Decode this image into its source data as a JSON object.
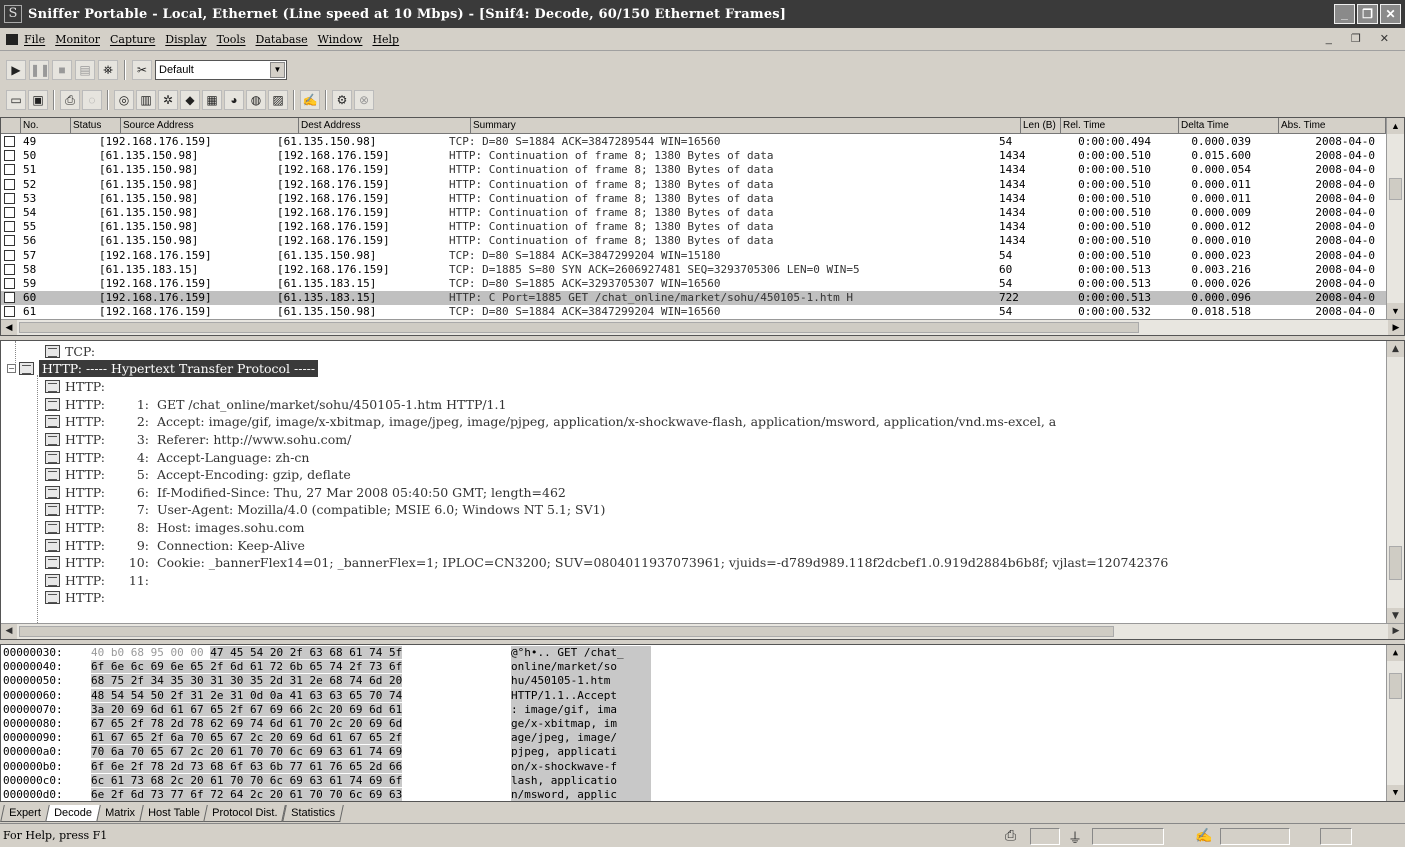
{
  "window": {
    "title": "Sniffer Portable - Local, Ethernet (Line speed at 10 Mbps) - [Snif4: Decode, 60/150 Ethernet Frames]",
    "app_icon": "S",
    "controls": [
      "_",
      "❐",
      "✕"
    ]
  },
  "menu": {
    "items": [
      "File",
      "Monitor",
      "Capture",
      "Display",
      "Tools",
      "Database",
      "Window",
      "Help"
    ],
    "mdi_controls": "_ ❐ ✕"
  },
  "toolbar1": {
    "profile_select": "Default"
  },
  "packet_list": {
    "columns": [
      "No.",
      "Status",
      "Source Address",
      "Dest Address",
      "Summary",
      "Len (B)",
      "Rel. Time",
      "Delta Time",
      "Abs. Time"
    ],
    "rows": [
      {
        "no": "49",
        "src": "[192.168.176.159]",
        "dst": "[61.135.150.98]",
        "summary": "TCP: D=80 S=1884     ACK=3847289544 WIN=16560",
        "len": "54",
        "rel": "0:00:00.494",
        "delta": "0.000.039",
        "abs": "2008-04-0"
      },
      {
        "no": "50",
        "src": "[61.135.150.98]",
        "dst": "[192.168.176.159]",
        "summary": "HTTP: Continuation of frame 8; 1380 Bytes of data",
        "len": "1434",
        "rel": "0:00:00.510",
        "delta": "0.015.600",
        "abs": "2008-04-0"
      },
      {
        "no": "51",
        "src": "[61.135.150.98]",
        "dst": "[192.168.176.159]",
        "summary": "HTTP: Continuation of frame 8; 1380 Bytes of data",
        "len": "1434",
        "rel": "0:00:00.510",
        "delta": "0.000.054",
        "abs": "2008-04-0"
      },
      {
        "no": "52",
        "src": "[61.135.150.98]",
        "dst": "[192.168.176.159]",
        "summary": "HTTP: Continuation of frame 8; 1380 Bytes of data",
        "len": "1434",
        "rel": "0:00:00.510",
        "delta": "0.000.011",
        "abs": "2008-04-0"
      },
      {
        "no": "53",
        "src": "[61.135.150.98]",
        "dst": "[192.168.176.159]",
        "summary": "HTTP: Continuation of frame 8; 1380 Bytes of data",
        "len": "1434",
        "rel": "0:00:00.510",
        "delta": "0.000.011",
        "abs": "2008-04-0"
      },
      {
        "no": "54",
        "src": "[61.135.150.98]",
        "dst": "[192.168.176.159]",
        "summary": "HTTP: Continuation of frame 8; 1380 Bytes of data",
        "len": "1434",
        "rel": "0:00:00.510",
        "delta": "0.000.009",
        "abs": "2008-04-0"
      },
      {
        "no": "55",
        "src": "[61.135.150.98]",
        "dst": "[192.168.176.159]",
        "summary": "HTTP: Continuation of frame 8; 1380 Bytes of data",
        "len": "1434",
        "rel": "0:00:00.510",
        "delta": "0.000.012",
        "abs": "2008-04-0"
      },
      {
        "no": "56",
        "src": "[61.135.150.98]",
        "dst": "[192.168.176.159]",
        "summary": "HTTP: Continuation of frame 8; 1380 Bytes of data",
        "len": "1434",
        "rel": "0:00:00.510",
        "delta": "0.000.010",
        "abs": "2008-04-0"
      },
      {
        "no": "57",
        "src": "[192.168.176.159]",
        "dst": "[61.135.150.98]",
        "summary": "TCP: D=80 S=1884     ACK=3847299204 WIN=15180",
        "len": "54",
        "rel": "0:00:00.510",
        "delta": "0.000.023",
        "abs": "2008-04-0"
      },
      {
        "no": "58",
        "src": "[61.135.183.15]",
        "dst": "[192.168.176.159]",
        "summary": "TCP: D=1885 S=80 SYN ACK=2606927481 SEQ=3293705306 LEN=0 WIN=5",
        "len": "60",
        "rel": "0:00:00.513",
        "delta": "0.003.216",
        "abs": "2008-04-0"
      },
      {
        "no": "59",
        "src": "[192.168.176.159]",
        "dst": "[61.135.183.15]",
        "summary": "TCP: D=80 S=1885     ACK=3293705307 WIN=16560",
        "len": "54",
        "rel": "0:00:00.513",
        "delta": "0.000.026",
        "abs": "2008-04-0"
      },
      {
        "no": "60",
        "src": "[192.168.176.159]",
        "dst": "[61.135.183.15]",
        "summary": "HTTP: C Port=1885  GET /chat_online/market/sohu/450105-1.htm H",
        "len": "722",
        "rel": "0:00:00.513",
        "delta": "0.000.096",
        "abs": "2008-04-0",
        "selected": true
      },
      {
        "no": "61",
        "src": "[192.168.176.159]",
        "dst": "[61.135.150.98]",
        "summary": "TCP: D=80 S=1884     ACK=3847299204 WIN=16560",
        "len": "54",
        "rel": "0:00:00.532",
        "delta": "0.018.518",
        "abs": "2008-04-0"
      }
    ]
  },
  "decode": {
    "tcp_node": "TCP:",
    "http_node": "HTTP: ----- Hypertext Transfer Protocol -----",
    "lines": [
      {
        "prefix": "HTTP:",
        "num": "",
        "text": ""
      },
      {
        "prefix": "HTTP:",
        "num": "1:",
        "text": "GET /chat_online/market/sohu/450105-1.htm HTTP/1.1"
      },
      {
        "prefix": "HTTP:",
        "num": "2:",
        "text": "Accept: image/gif, image/x-xbitmap, image/jpeg, image/pjpeg, application/x-shockwave-flash, application/msword, application/vnd.ms-excel, a"
      },
      {
        "prefix": "HTTP:",
        "num": "3:",
        "text": "Referer: http://www.sohu.com/"
      },
      {
        "prefix": "HTTP:",
        "num": "4:",
        "text": "Accept-Language: zh-cn"
      },
      {
        "prefix": "HTTP:",
        "num": "5:",
        "text": "Accept-Encoding: gzip, deflate"
      },
      {
        "prefix": "HTTP:",
        "num": "6:",
        "text": "If-Modified-Since: Thu, 27 Mar 2008 05:40:50 GMT; length=462"
      },
      {
        "prefix": "HTTP:",
        "num": "7:",
        "text": "User-Agent: Mozilla/4.0 (compatible; MSIE 6.0; Windows NT 5.1; SV1)"
      },
      {
        "prefix": "HTTP:",
        "num": "8:",
        "text": "Host: images.sohu.com"
      },
      {
        "prefix": "HTTP:",
        "num": "9:",
        "text": "Connection: Keep-Alive"
      },
      {
        "prefix": "HTTP:",
        "num": "10:",
        "text": "Cookie: _bannerFlex14=01; _bannerFlex=1; IPLOC=CN3200; SUV=0804011937073961; vjuids=-d789d989.118f2dcbef1.0.919d2884b6b8f; vjlast=120742376"
      },
      {
        "prefix": "HTTP:",
        "num": "11:",
        "text": ""
      },
      {
        "prefix": "HTTP:",
        "num": "",
        "text": ""
      }
    ]
  },
  "hex": {
    "rows": [
      {
        "off": "00000030:",
        "dim": "40 b0 68 95 00 00 ",
        "bytes": "47 45 54 20 2f 63 68 61 74 5f",
        "ascii": "@°h•.. GET /chat_"
      },
      {
        "off": "00000040:",
        "dim": "",
        "bytes": "6f 6e 6c 69 6e 65 2f 6d 61 72 6b 65 74 2f 73 6f",
        "ascii": "online/market/so"
      },
      {
        "off": "00000050:",
        "dim": "",
        "bytes": "68 75 2f 34 35 30 31 30 35 2d 31 2e 68 74 6d 20",
        "ascii": "hu/450105-1.htm "
      },
      {
        "off": "00000060:",
        "dim": "",
        "bytes": "48 54 54 50 2f 31 2e 31 0d 0a 41 63 63 65 70 74",
        "ascii": "HTTP/1.1..Accept"
      },
      {
        "off": "00000070:",
        "dim": "",
        "bytes": "3a 20 69 6d 61 67 65 2f 67 69 66 2c 20 69 6d 61",
        "ascii": ": image/gif, ima"
      },
      {
        "off": "00000080:",
        "dim": "",
        "bytes": "67 65 2f 78 2d 78 62 69 74 6d 61 70 2c 20 69 6d",
        "ascii": "ge/x-xbitmap, im"
      },
      {
        "off": "00000090:",
        "dim": "",
        "bytes": "61 67 65 2f 6a 70 65 67 2c 20 69 6d 61 67 65 2f",
        "ascii": "age/jpeg, image/"
      },
      {
        "off": "000000a0:",
        "dim": "",
        "bytes": "70 6a 70 65 67 2c 20 61 70 70 6c 69 63 61 74 69",
        "ascii": "pjpeg, applicati"
      },
      {
        "off": "000000b0:",
        "dim": "",
        "bytes": "6f 6e 2f 78 2d 73 68 6f 63 6b 77 61 76 65 2d 66",
        "ascii": "on/x-shockwave-f"
      },
      {
        "off": "000000c0:",
        "dim": "",
        "bytes": "6c 61 73 68 2c 20 61 70 70 6c 69 63 61 74 69 6f",
        "ascii": "lash, applicatio"
      },
      {
        "off": "000000d0:",
        "dim": "",
        "bytes": "6e 2f 6d 73 77 6f 72 64 2c 20 61 70 70 6c 69 63",
        "ascii": "n/msword, applic"
      }
    ]
  },
  "tabs": [
    "Expert",
    "Decode",
    "Matrix",
    "Host Table",
    "Protocol Dist.",
    "Statistics"
  ],
  "active_tab": "Decode",
  "status": {
    "help_text": "For Help, press F1"
  },
  "colors": {
    "title_bar": "#3a3a3a",
    "selected_row": "#c0c0c0",
    "window_face": "#d4d0c8"
  }
}
